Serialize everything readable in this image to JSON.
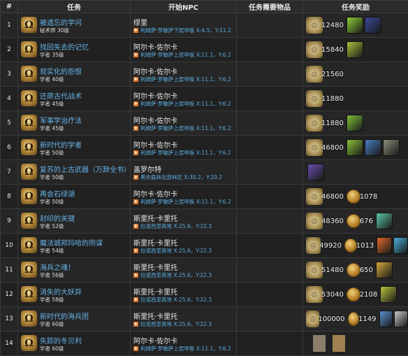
{
  "headers": [
    "#",
    "任务",
    "开始NPC",
    "任务需要物品",
    "任务奖励"
  ],
  "rows": [
    {
      "num": "1",
      "title": "被遗忘的学问",
      "level": "秘术师 30级",
      "npc": "缪里",
      "loc": "利姆萨·罗敏萨下层甲板 X:4.5，Y:11.2",
      "gil": "12480",
      "coin": "",
      "items": [
        "#8fcf3a",
        "#3b4a9a"
      ]
    },
    {
      "num": "2",
      "title": "找回失去的记忆",
      "level": "学者 35级",
      "npc": "阿尔卡·佐尔卡",
      "loc": "利姆萨·罗敏萨上层甲板 X:11.1，Y:6.2",
      "gil": "15840",
      "coin": "",
      "items": [
        "#a9c23a"
      ]
    },
    {
      "num": "3",
      "title": "现实化的怨恨",
      "level": "学者 40级",
      "npc": "阿尔卡·佐尔卡",
      "loc": "利姆萨·罗敏萨上层甲板 X:11.1，Y:6.2",
      "gil": "21560",
      "coin": "",
      "items": []
    },
    {
      "num": "4",
      "title": "还原古代战术",
      "level": "学者 45级",
      "npc": "阿尔卡·佐尔卡",
      "loc": "利姆萨·罗敏萨上层甲板 X:11.1，Y:6.2",
      "gil": "11880",
      "coin": "",
      "items": []
    },
    {
      "num": "5",
      "title": "军事学治疗法",
      "level": "学者 45级",
      "npc": "阿尔卡·佐尔卡",
      "loc": "利姆萨·罗敏萨上层甲板 X:11.1，Y:6.2",
      "gil": "11880",
      "coin": "",
      "items": [
        "#7fc13a"
      ]
    },
    {
      "num": "6",
      "title": "新时代的学者",
      "level": "学者 50级",
      "npc": "阿尔卡·佐尔卡",
      "loc": "利姆萨·罗敏萨上层甲板 X:11.1，Y:6.2",
      "gil": "46800",
      "coin": "",
      "items": [
        "#8ac23a",
        "#4a7fc0",
        "#8c8c7a"
      ]
    },
    {
      "num": "7",
      "title": "复苏的上古武器（万辞全书）",
      "level": "学者 50级",
      "npc": "盖罗尔特",
      "loc": "黑衣森林北部林区 X:30.2，Y:20.2",
      "gil": "",
      "coin": "",
      "items": [
        "#6a4fb0"
      ]
    },
    {
      "num": "8",
      "title": "再会石绿湖",
      "level": "学者 50级",
      "npc": "阿尔卡·佐尔卡",
      "loc": "利姆萨·罗敏萨上层甲板 X:11.1，Y:6.2",
      "gil": "46800",
      "coin": "1078",
      "items": []
    },
    {
      "num": "9",
      "title": "封印的关键",
      "level": "学者 52级",
      "npc": "斯里托·卡里托",
      "loc": "拉诺西亚高地 X:25.6，Y:22.3",
      "gil": "48360",
      "coin": "676",
      "items": [
        "#5cc8a8"
      ]
    },
    {
      "num": "10",
      "title": "魔法城邦玛哈的阴谋",
      "level": "学者 54级",
      "npc": "斯里托·卡里托",
      "loc": "拉诺西亚高地 X:25.6，Y:22.3",
      "gil": "49920",
      "coin": "1013",
      "items": [
        "#e06a2a",
        "#4ab0d8"
      ]
    },
    {
      "num": "11",
      "title": "海兵之魂！",
      "level": "学者 56级",
      "npc": "斯里托·卡里托",
      "loc": "拉诺西亚高地 X:25.6，Y:22.3",
      "gil": "51480",
      "coin": "650",
      "items": [
        "#d4a83a"
      ]
    },
    {
      "num": "12",
      "title": "消失的大妖异",
      "level": "学者 58级",
      "npc": "斯里托·卡里托",
      "loc": "拉诺西亚高地 X:25.6，Y:22.3",
      "gil": "53040",
      "coin": "2108",
      "items": [
        "#b8c23a"
      ]
    },
    {
      "num": "13",
      "title": "新时代的海兵团",
      "level": "学者 60级",
      "npc": "斯里托·卡里托",
      "loc": "拉诺西亚高地 X:25.6，Y:22.3",
      "gil": "100000",
      "coin": "1149",
      "items": [
        "#5a90d0",
        "#c8c8c8"
      ]
    },
    {
      "num": "14",
      "title": "失踪的冬贝利",
      "level": "学者 60级",
      "npc": "阿尔卡·佐尔卡",
      "loc": "利姆萨·罗敏萨上层甲板 X:11.1，Y:6.2",
      "gil": "",
      "coin": "",
      "items": [],
      "placeholders": [
        "#8a7d6a",
        "#a08050"
      ]
    }
  ]
}
